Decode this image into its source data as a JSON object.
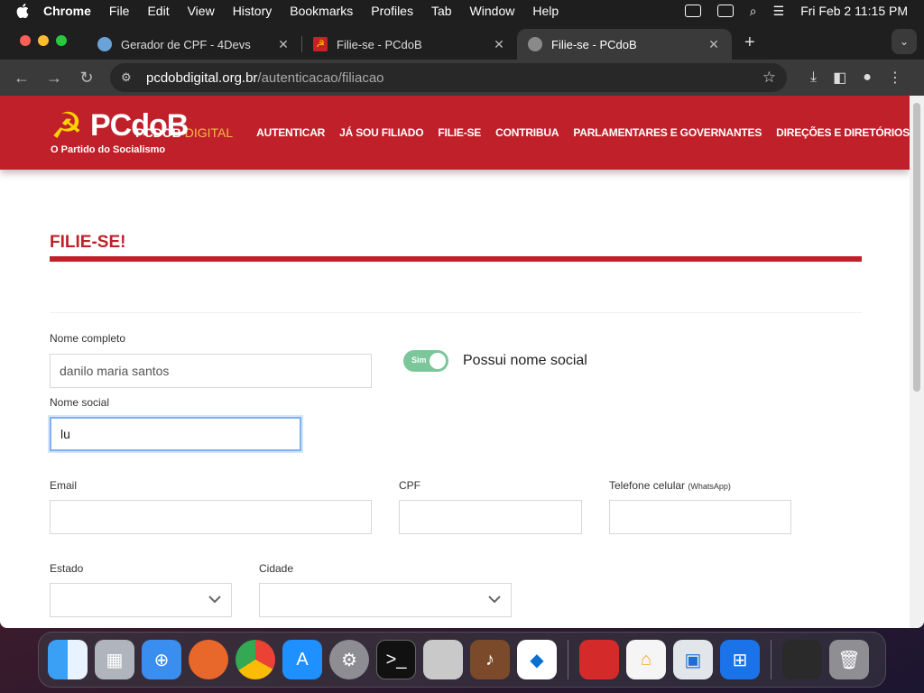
{
  "menubar": {
    "app": "Chrome",
    "items": [
      "File",
      "Edit",
      "View",
      "History",
      "Bookmarks",
      "Profiles",
      "Tab",
      "Window",
      "Help"
    ],
    "datetime": "Fri Feb 2  11:15 PM"
  },
  "browser": {
    "tabs": [
      {
        "title": "Gerador de CPF - 4Devs",
        "favicon": "globe-icon"
      },
      {
        "title": "Filie-se - PCdoB",
        "favicon": "pcdob-icon"
      },
      {
        "title": "Filie-se - PCdoB",
        "favicon": "globe-icon"
      }
    ],
    "url_host": "pcdobdigital.org.br",
    "url_path": "/autenticacao/filiacao"
  },
  "site": {
    "logo_brand": "PCdoB",
    "logo_tagline": "O Partido do Socialismo",
    "name_main": "PCDOB",
    "name_accent": " DIGITAL",
    "nav": [
      "AUTENTICAR",
      "JÁ SOU FILIADO",
      "FILIE-SE",
      "CONTRIBUA",
      "PARLAMENTARES E GOVERNANTES",
      "DIREÇÕES E DIRETÓRIOS"
    ],
    "accent_color": "#c0202a"
  },
  "form": {
    "title": "FILIE-SE!",
    "full_name_label": "Nome completo",
    "full_name_value": "danilo maria santos",
    "social_toggle_text": "Sim",
    "social_toggle_label": "Possui nome social",
    "social_name_label": "Nome social",
    "social_name_value": "lu",
    "email_label": "Email",
    "cpf_label": "CPF",
    "phone_label": "Telefone celular",
    "phone_label_note": "(WhatsApp)",
    "state_label": "Estado",
    "city_label": "Cidade"
  }
}
